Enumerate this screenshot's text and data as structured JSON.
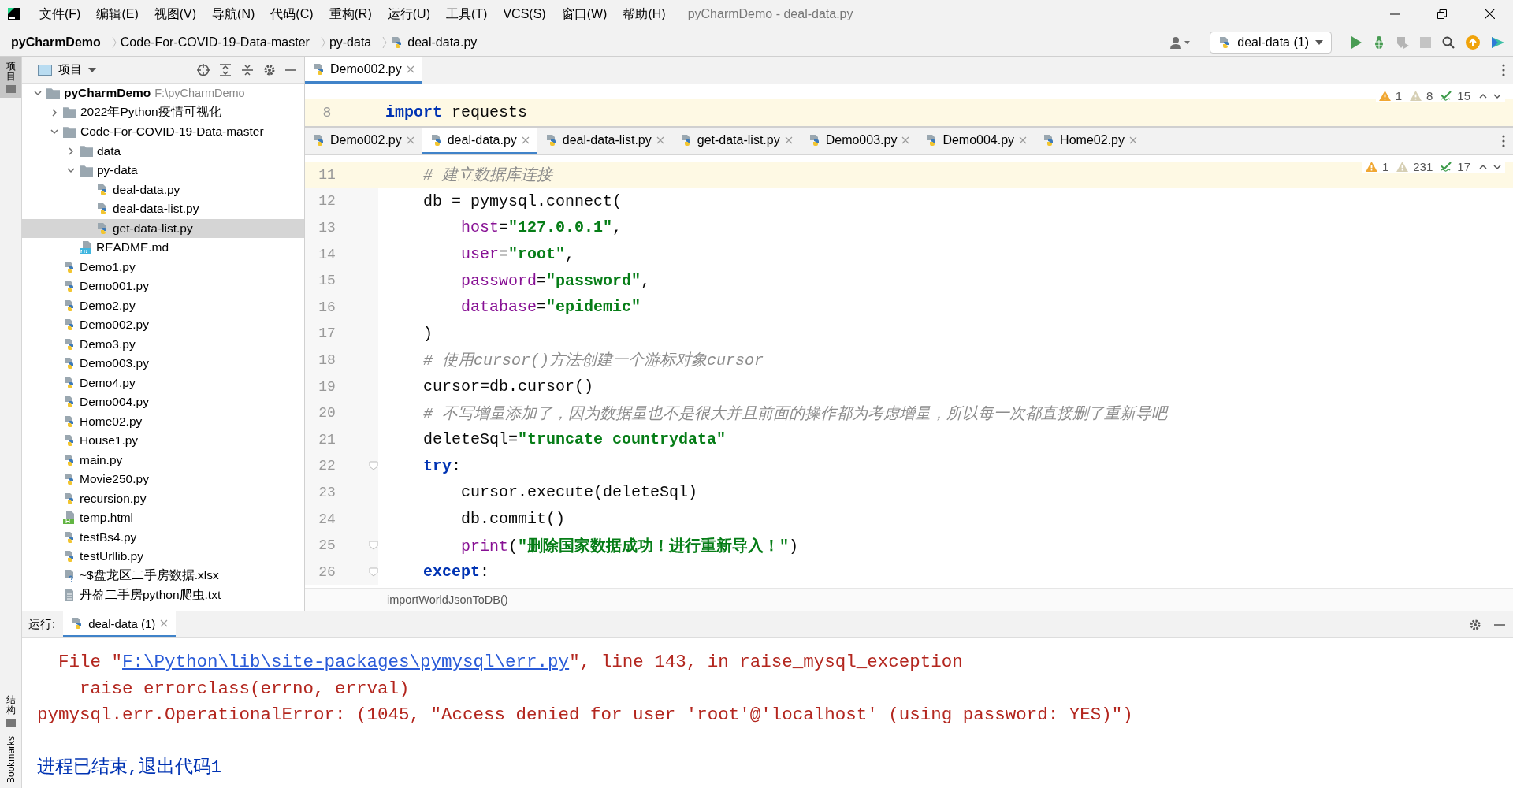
{
  "window": {
    "title": "pyCharmDemo - deal-data.py"
  },
  "menu": [
    "文件(F)",
    "编辑(E)",
    "视图(V)",
    "导航(N)",
    "代码(C)",
    "重构(R)",
    "运行(U)",
    "工具(T)",
    "VCS(S)",
    "窗口(W)",
    "帮助(H)"
  ],
  "breadcrumbs": [
    {
      "label": "pyCharmDemo",
      "kind": "project"
    },
    {
      "label": "Code-For-COVID-19-Data-master",
      "kind": "folder"
    },
    {
      "label": "py-data",
      "kind": "folder"
    },
    {
      "label": "deal-data.py",
      "kind": "python"
    }
  ],
  "run_config": {
    "label": "deal-data (1)"
  },
  "side_stripe": [
    {
      "label": "项目",
      "kind": "cjk",
      "selected": true
    },
    {
      "label": "结构",
      "kind": "cjk",
      "selected": false
    },
    {
      "label": "Bookmarks",
      "kind": "latin",
      "selected": false
    }
  ],
  "project_panel": {
    "title": "项目",
    "tree": [
      {
        "label": "pyCharmDemo",
        "path": "F:\\pyCharmDemo",
        "kind": "folder",
        "expanded": true,
        "selected": false,
        "children": [
          {
            "label": "2022年Python疫情可视化",
            "kind": "folder",
            "expanded": false,
            "selected": false
          },
          {
            "label": "Code-For-COVID-19-Data-master",
            "kind": "folder",
            "expanded": true,
            "selected": false,
            "children": [
              {
                "label": "data",
                "kind": "folder",
                "expanded": false,
                "selected": false
              },
              {
                "label": "py-data",
                "kind": "folder",
                "expanded": true,
                "selected": false,
                "children": [
                  {
                    "label": "deal-data.py",
                    "kind": "python",
                    "selected": false
                  },
                  {
                    "label": "deal-data-list.py",
                    "kind": "python",
                    "selected": false
                  },
                  {
                    "label": "get-data-list.py",
                    "kind": "python",
                    "selected": true
                  }
                ]
              },
              {
                "label": "README.md",
                "kind": "markdown",
                "selected": false
              }
            ]
          },
          {
            "label": "Demo1.py",
            "kind": "python",
            "selected": false
          },
          {
            "label": "Demo001.py",
            "kind": "python",
            "selected": false
          },
          {
            "label": "Demo2.py",
            "kind": "python",
            "selected": false
          },
          {
            "label": "Demo002.py",
            "kind": "python",
            "selected": false
          },
          {
            "label": "Demo3.py",
            "kind": "python",
            "selected": false
          },
          {
            "label": "Demo003.py",
            "kind": "python",
            "selected": false
          },
          {
            "label": "Demo4.py",
            "kind": "python",
            "selected": false
          },
          {
            "label": "Demo004.py",
            "kind": "python",
            "selected": false
          },
          {
            "label": "Home02.py",
            "kind": "python",
            "selected": false
          },
          {
            "label": "House1.py",
            "kind": "python",
            "selected": false
          },
          {
            "label": "main.py",
            "kind": "python",
            "selected": false
          },
          {
            "label": "Movie250.py",
            "kind": "python",
            "selected": false
          },
          {
            "label": "recursion.py",
            "kind": "python",
            "selected": false
          },
          {
            "label": "temp.html",
            "kind": "html",
            "selected": false
          },
          {
            "label": "testBs4.py",
            "kind": "python",
            "selected": false
          },
          {
            "label": "testUrllib.py",
            "kind": "python",
            "selected": false
          },
          {
            "label": "~$盘龙区二手房数据.xlsx",
            "kind": "unknown",
            "selected": false
          },
          {
            "label": "丹盈二手房python爬虫.txt",
            "kind": "text",
            "selected": false
          }
        ]
      }
    ]
  },
  "editor_top": {
    "tabs": [
      {
        "label": "Demo002.py",
        "selected": true
      }
    ],
    "inspections": {
      "errors": "1",
      "warnings": "8",
      "typos": "15"
    },
    "lines": [
      {
        "number": "8",
        "current": true,
        "tokens": [
          {
            "kind": "keyword",
            "text": "import"
          },
          {
            "kind": "plain",
            "text": " requests"
          }
        ]
      }
    ]
  },
  "editor_bottom": {
    "tabs": [
      {
        "label": "Demo002.py",
        "selected": false
      },
      {
        "label": "deal-data.py",
        "selected": true
      },
      {
        "label": "deal-data-list.py",
        "selected": false
      },
      {
        "label": "get-data-list.py",
        "selected": false
      },
      {
        "label": "Demo003.py",
        "selected": false
      },
      {
        "label": "Demo004.py",
        "selected": false
      },
      {
        "label": "Home02.py",
        "selected": false
      }
    ],
    "inspections": {
      "errors": "1",
      "warnings": "231",
      "typos": "17"
    },
    "lines": [
      {
        "number": "11",
        "current": true,
        "tokens": [
          {
            "kind": "comment",
            "text": "    # 建立数据库连接"
          }
        ]
      },
      {
        "number": "12",
        "current": false,
        "tokens": [
          {
            "kind": "plain",
            "text": "    db = pymysql.connect("
          }
        ]
      },
      {
        "number": "13",
        "current": false,
        "tokens": [
          {
            "kind": "param",
            "text": "        host"
          },
          {
            "kind": "plain",
            "text": "="
          },
          {
            "kind": "string",
            "text": "\"127.0.0.1\""
          },
          {
            "kind": "plain",
            "text": ","
          }
        ]
      },
      {
        "number": "14",
        "current": false,
        "tokens": [
          {
            "kind": "param",
            "text": "        user"
          },
          {
            "kind": "plain",
            "text": "="
          },
          {
            "kind": "string",
            "text": "\"root\""
          },
          {
            "kind": "plain",
            "text": ","
          }
        ]
      },
      {
        "number": "15",
        "current": false,
        "tokens": [
          {
            "kind": "param",
            "text": "        password"
          },
          {
            "kind": "plain",
            "text": "="
          },
          {
            "kind": "string",
            "text": "\"password\""
          },
          {
            "kind": "plain",
            "text": ","
          }
        ]
      },
      {
        "number": "16",
        "current": false,
        "tokens": [
          {
            "kind": "param",
            "text": "        database"
          },
          {
            "kind": "plain",
            "text": "="
          },
          {
            "kind": "string",
            "text": "\"epidemic\""
          }
        ]
      },
      {
        "number": "17",
        "current": false,
        "tokens": [
          {
            "kind": "plain",
            "text": "    )"
          }
        ]
      },
      {
        "number": "18",
        "current": false,
        "tokens": [
          {
            "kind": "comment",
            "text": "    # 使用cursor()方法创建一个游标对象cursor"
          }
        ]
      },
      {
        "number": "19",
        "current": false,
        "tokens": [
          {
            "kind": "plain",
            "text": "    cursor=db.cursor()"
          }
        ]
      },
      {
        "number": "20",
        "current": false,
        "tokens": [
          {
            "kind": "comment",
            "text": "    # 不写增量添加了，因为数据量也不是很大并且前面的操作都为考虑增量，所以每一次都直接删了重新导吧"
          }
        ]
      },
      {
        "number": "21",
        "current": false,
        "tokens": [
          {
            "kind": "plain",
            "text": "    deleteSql="
          },
          {
            "kind": "string",
            "text": "\"truncate countrydata\""
          }
        ]
      },
      {
        "number": "22",
        "current": false,
        "fold": true,
        "tokens": [
          {
            "kind": "keyword",
            "text": "    try"
          },
          {
            "kind": "plain",
            "text": ":"
          }
        ]
      },
      {
        "number": "23",
        "current": false,
        "tokens": [
          {
            "kind": "plain",
            "text": "        cursor.execute(deleteSql)"
          }
        ]
      },
      {
        "number": "24",
        "current": false,
        "tokens": [
          {
            "kind": "plain",
            "text": "        db.commit()"
          }
        ]
      },
      {
        "number": "25",
        "current": false,
        "fold": true,
        "tokens": [
          {
            "kind": "param",
            "text": "        print"
          },
          {
            "kind": "plain",
            "text": "("
          },
          {
            "kind": "string",
            "text": "\"删除国家数据成功！进行重新导入！\""
          },
          {
            "kind": "plain",
            "text": ")"
          }
        ]
      },
      {
        "number": "26",
        "current": false,
        "fold": true,
        "tokens": [
          {
            "kind": "keyword",
            "text": "    except"
          },
          {
            "kind": "plain",
            "text": ":"
          }
        ]
      }
    ],
    "breadcrumb": "importWorldJsonToDB()"
  },
  "run_panel": {
    "label": "运行:",
    "tabs": [
      {
        "label": "deal-data (1)",
        "selected": true
      }
    ],
    "output": [
      {
        "kind": "error",
        "parts": [
          {
            "kind": "text",
            "text": "  File \""
          },
          {
            "kind": "link",
            "text": "F:\\Python\\lib\\site-packages\\pymysql\\err.py"
          },
          {
            "kind": "text",
            "text": "\", line 143, in raise_mysql_exception"
          }
        ]
      },
      {
        "kind": "error",
        "parts": [
          {
            "kind": "text",
            "text": "    raise errorclass(errno, errval)"
          }
        ]
      },
      {
        "kind": "error",
        "parts": [
          {
            "kind": "text",
            "text": "pymysql.err.OperationalError: (1045, \"Access denied for user 'root'@'localhost' (using password: YES)\")"
          }
        ]
      },
      {
        "kind": "info",
        "parts": [
          {
            "kind": "text",
            "text": "进程已结束,退出代码1"
          }
        ]
      }
    ]
  }
}
